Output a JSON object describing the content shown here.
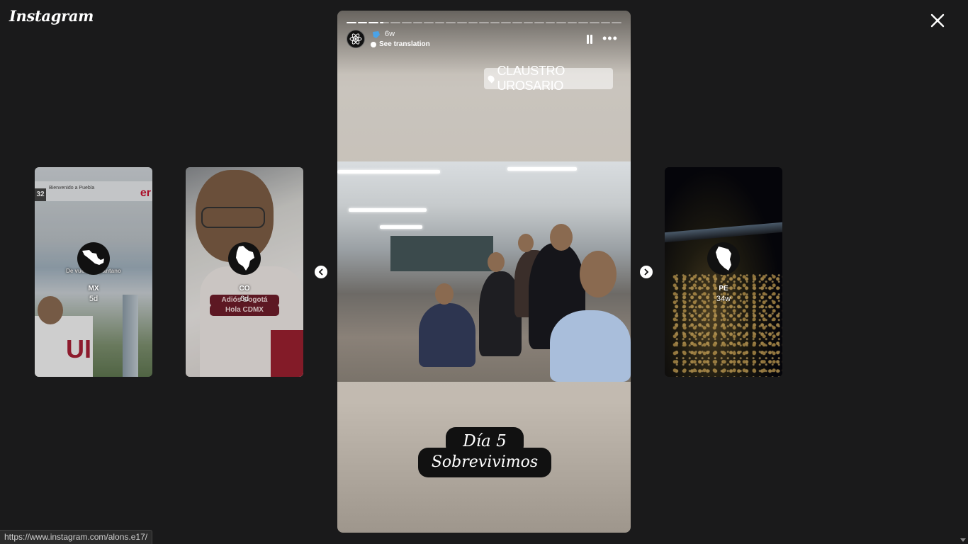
{
  "app": {
    "logo": "Instagram"
  },
  "status_url": "https://www.instagram.com/alons.e17/",
  "previews": [
    {
      "id": "mx",
      "name": "MX",
      "time": "5d",
      "sign_text": "Bienvenido a Puebla",
      "sign_num": "32",
      "sign_brand": "er",
      "caption": "De vuelta al pantano"
    },
    {
      "id": "co",
      "name": "CO",
      "time": "6d",
      "label_1": "Adiós Bogotá",
      "label_2": "Hola CDMX"
    },
    {
      "id": "pe",
      "name": "PE",
      "time": "34w"
    }
  ],
  "story": {
    "time": "6w",
    "see_translation": "See translation",
    "location": "CLAUSTRO UROSARIO",
    "caption_line_1": "Día 5",
    "caption_line_2": "Sobrevivimos",
    "progress_total": 25,
    "progress_done": 3,
    "more_label": "•••"
  },
  "colors": {
    "background": "#1a1a1b",
    "caption_box": "#111111",
    "co_label": "#6e1d2a"
  }
}
